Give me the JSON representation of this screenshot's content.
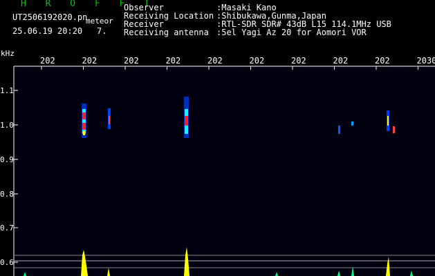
{
  "header": {
    "title": "H R O F F T",
    "filename": "UT2506192020.pn",
    "tag": "meteor",
    "date_time": "25.06.19 20:20",
    "count": "7."
  },
  "info": {
    "observer_label": "Observer",
    "observer_value": ":Masaki Kano",
    "location_label": "Receiving Location",
    "location_value": ":Shibukawa,Gunma,Japan",
    "receiver_label": "Receiver",
    "receiver_value": ":RTL-SDR SDR# 43dB L15 114.1MHz USB",
    "antenna_label": "Receiving antenna",
    "antenna_value": ":5el Yagi Az 20 for Aomori VOR"
  },
  "chart_data": {
    "type": "heatmap",
    "ylabel": "kHz",
    "y_ticks": [
      "1.1",
      "1.0",
      "0.9",
      "0.8",
      "0.7",
      "0.6"
    ],
    "x_ticks": [
      "202",
      "202",
      "202",
      "202",
      "202",
      "202",
      "202",
      "202",
      "202",
      "2030"
    ],
    "colors": {
      "background": "#000010",
      "signal_hot": "#ff2020",
      "signal_mid": "#00ffff",
      "signal_low": "#0040ff",
      "trace": "#ffff00"
    }
  }
}
